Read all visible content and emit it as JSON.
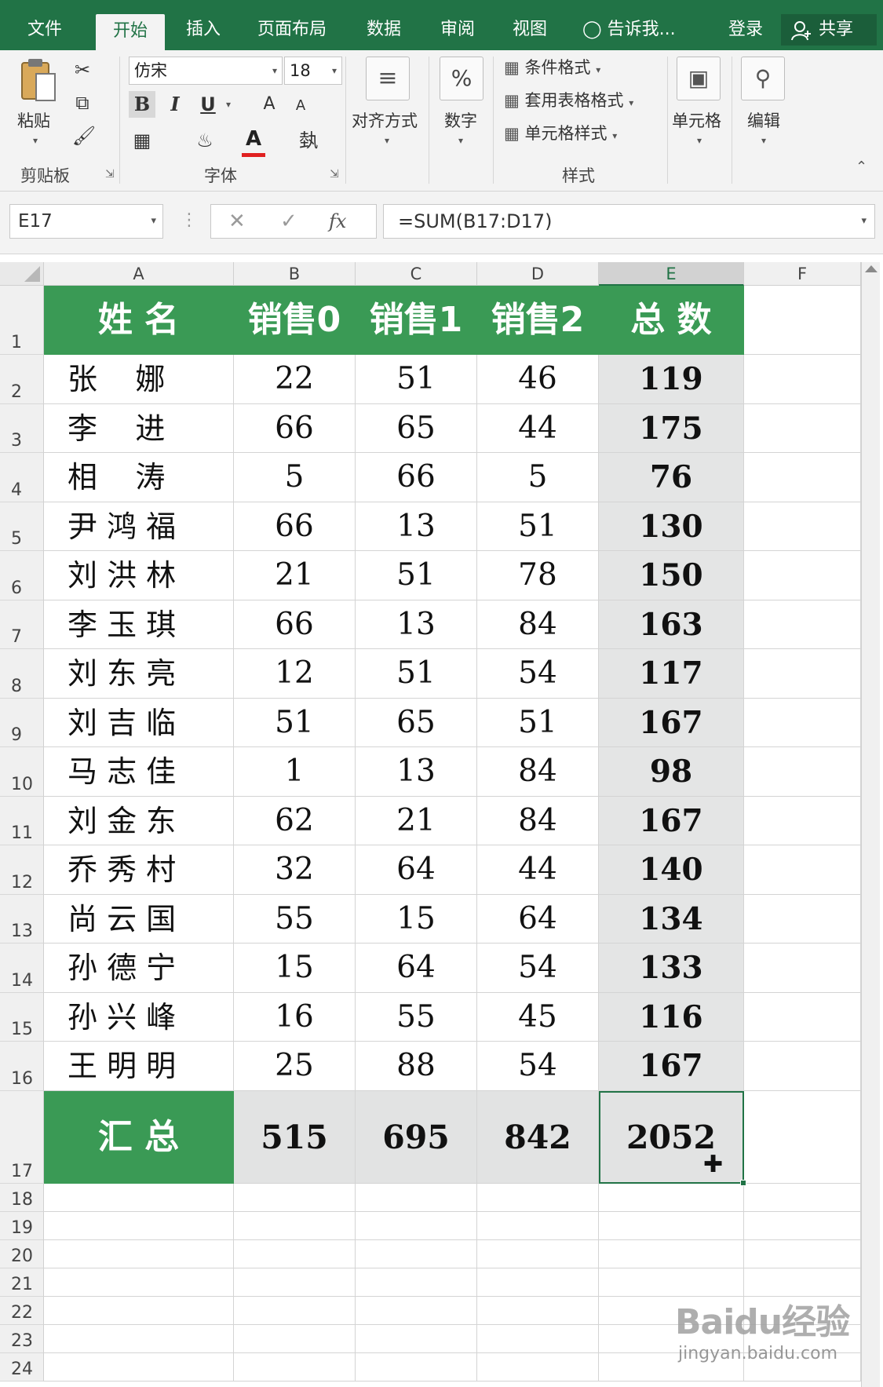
{
  "tabs": [
    "文件",
    "开始",
    "插入",
    "页面布局",
    "数据",
    "审阅",
    "视图"
  ],
  "active_tab": "开始",
  "tell_me": "告诉我...",
  "login": "登录",
  "share": "共享",
  "ribbon": {
    "clipboard": {
      "paste": "粘贴",
      "label": "剪贴板"
    },
    "font": {
      "name": "仿宋",
      "size": "18",
      "bold": "B",
      "italic": "I",
      "underline": "U",
      "grow": "A",
      "shrink": "A",
      "color_letter": "A",
      "label": "字体",
      "font_color": "#e02020"
    },
    "alignment": {
      "label": "对齐方式"
    },
    "number": {
      "label": "数字",
      "symbol": "%"
    },
    "styles": {
      "conditional": "条件格式",
      "table_format": "套用表格格式",
      "cell_styles": "单元格样式",
      "label": "样式"
    },
    "cells": {
      "label": "单元格"
    },
    "editing": {
      "label": "编辑"
    }
  },
  "formula_bar": {
    "name_box": "E17",
    "fx": "fx",
    "formula": "=SUM(B17:D17)"
  },
  "sheet": {
    "columns": [
      "A",
      "B",
      "C",
      "D",
      "E",
      "F"
    ],
    "selected_column": "E",
    "header_row": {
      "row": "1",
      "cells": [
        "姓  名",
        "销售0",
        "销售1",
        "销售2",
        "总  数"
      ]
    },
    "rows": [
      {
        "row": "2",
        "name": "张    娜",
        "b": "22",
        "c": "51",
        "d": "46",
        "total": "119"
      },
      {
        "row": "3",
        "name": "李    进",
        "b": "66",
        "c": "65",
        "d": "44",
        "total": "175"
      },
      {
        "row": "4",
        "name": "相    涛",
        "b": "5",
        "c": "66",
        "d": "5",
        "total": "76"
      },
      {
        "row": "5",
        "name": "尹 鸿 福",
        "b": "66",
        "c": "13",
        "d": "51",
        "total": "130"
      },
      {
        "row": "6",
        "name": "刘 洪 林",
        "b": "21",
        "c": "51",
        "d": "78",
        "total": "150"
      },
      {
        "row": "7",
        "name": "李 玉 琪",
        "b": "66",
        "c": "13",
        "d": "84",
        "total": "163"
      },
      {
        "row": "8",
        "name": "刘 东 亮",
        "b": "12",
        "c": "51",
        "d": "54",
        "total": "117"
      },
      {
        "row": "9",
        "name": "刘 吉 临",
        "b": "51",
        "c": "65",
        "d": "51",
        "total": "167"
      },
      {
        "row": "10",
        "name": "马 志 佳",
        "b": "1",
        "c": "13",
        "d": "84",
        "total": "98"
      },
      {
        "row": "11",
        "name": "刘 金 东",
        "b": "62",
        "c": "21",
        "d": "84",
        "total": "167"
      },
      {
        "row": "12",
        "name": "乔 秀 村",
        "b": "32",
        "c": "64",
        "d": "44",
        "total": "140"
      },
      {
        "row": "13",
        "name": "尚 云 国",
        "b": "55",
        "c": "15",
        "d": "64",
        "total": "134"
      },
      {
        "row": "14",
        "name": "孙 德 宁",
        "b": "15",
        "c": "64",
        "d": "54",
        "total": "133"
      },
      {
        "row": "15",
        "name": "孙 兴 峰",
        "b": "16",
        "c": "55",
        "d": "45",
        "total": "116"
      },
      {
        "row": "16",
        "name": "王 明 明",
        "b": "25",
        "c": "88",
        "d": "54",
        "total": "167"
      }
    ],
    "summary_row": {
      "row": "17",
      "label": "汇  总",
      "b": "515",
      "c": "695",
      "d": "842",
      "total": "2052"
    },
    "empty_rows": [
      "18",
      "19",
      "20",
      "21",
      "22",
      "23",
      "24"
    ],
    "active_cell": "E17"
  },
  "watermark": {
    "logo": "Baidu经验",
    "url": "jingyan.baidu.com"
  },
  "colors": {
    "excel_green": "#217346",
    "header_green": "#3a9a55",
    "selected_gray": "#e4e5e5"
  }
}
